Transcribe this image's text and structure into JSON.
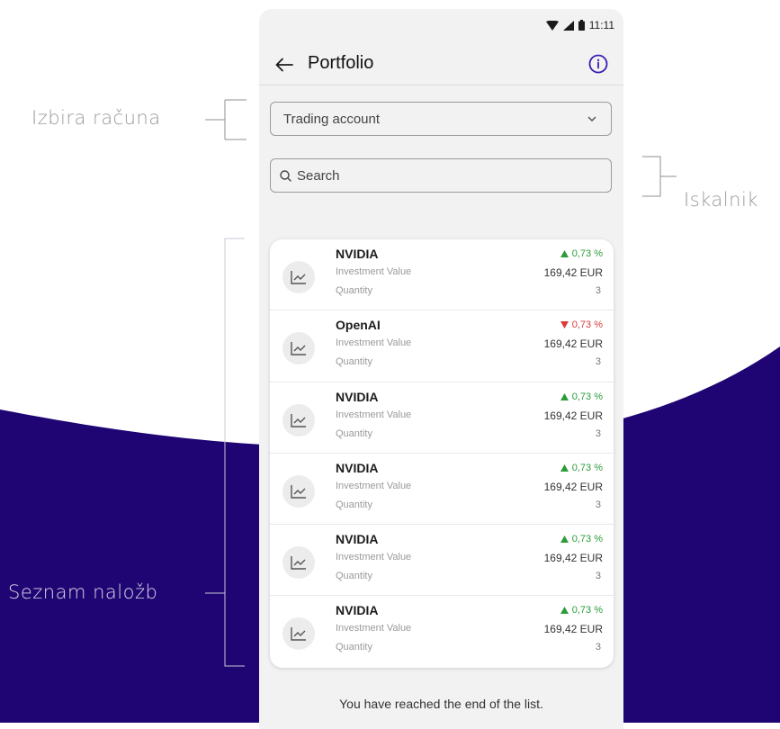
{
  "colors": {
    "background_top": "#ffffff",
    "background_wave": "#1f0473",
    "phone_bg": "#f2f2f2",
    "accent": "#3a1db0",
    "positive": "#2e9b3a",
    "negative": "#d93b3b"
  },
  "annotations": {
    "account_selection": "Izbira računa",
    "search": "Iskalnik",
    "investments_list": "Seznam naložb"
  },
  "status_bar": {
    "time": "11:11",
    "icons": [
      "wifi-icon",
      "signal-icon",
      "battery-icon"
    ]
  },
  "app_bar": {
    "title": "Portfolio",
    "back_icon": "arrow-left-icon",
    "info_icon": "info-circle-icon"
  },
  "account_select": {
    "value": "Trading account",
    "icon": "chevron-down-icon"
  },
  "search": {
    "placeholder": "Search",
    "icon": "search-icon"
  },
  "investments": [
    {
      "name": "NVIDIA",
      "value_label": "Investment Value",
      "quantity_label": "Quantity",
      "change": "0,73 %",
      "direction": "up",
      "value": "169,42 EUR",
      "quantity": "3",
      "icon": "line-chart-icon"
    },
    {
      "name": "OpenAI",
      "value_label": "Investment Value",
      "quantity_label": "Quantity",
      "change": "0,73 %",
      "direction": "down",
      "value": "169,42 EUR",
      "quantity": "3",
      "icon": "line-chart-icon"
    },
    {
      "name": "NVIDIA",
      "value_label": "Investment Value",
      "quantity_label": "Quantity",
      "change": "0,73 %",
      "direction": "up",
      "value": "169,42 EUR",
      "quantity": "3",
      "icon": "line-chart-icon"
    },
    {
      "name": "NVIDIA",
      "value_label": "Investment Value",
      "quantity_label": "Quantity",
      "change": "0,73 %",
      "direction": "up",
      "value": "169,42 EUR",
      "quantity": "3",
      "icon": "line-chart-icon"
    },
    {
      "name": "NVIDIA",
      "value_label": "Investment Value",
      "quantity_label": "Quantity",
      "change": "0,73 %",
      "direction": "up",
      "value": "169,42 EUR",
      "quantity": "3",
      "icon": "line-chart-icon"
    },
    {
      "name": "NVIDIA",
      "value_label": "Investment Value",
      "quantity_label": "Quantity",
      "change": "0,73 %",
      "direction": "up",
      "value": "169,42 EUR",
      "quantity": "3",
      "icon": "line-chart-icon"
    }
  ],
  "footer": {
    "end_of_list": "You have reached the end of the list."
  }
}
